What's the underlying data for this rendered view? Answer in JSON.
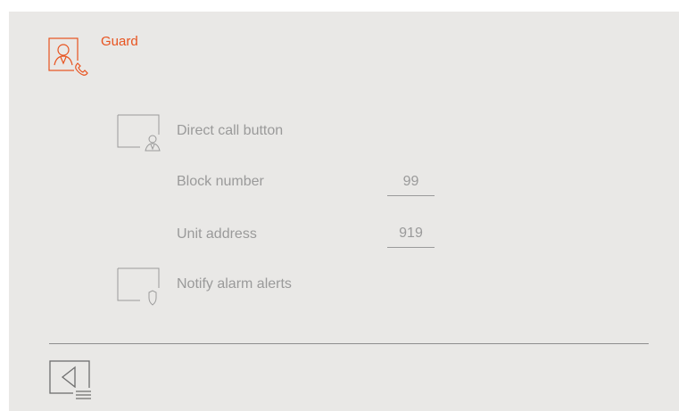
{
  "header": {
    "title": "Guard",
    "icon": "guard-phone-icon",
    "accent_color": "#e8531f"
  },
  "settings": {
    "direct_call": {
      "label": "Direct call button",
      "icon": "person-toggle-icon"
    },
    "block_number": {
      "label": "Block number",
      "value": "99"
    },
    "unit_address": {
      "label": "Unit address",
      "value": "919"
    },
    "notify_alarm": {
      "label": "Notify alarm alerts",
      "icon": "shield-toggle-icon"
    }
  },
  "footer": {
    "back_icon": "back-menu-icon"
  }
}
